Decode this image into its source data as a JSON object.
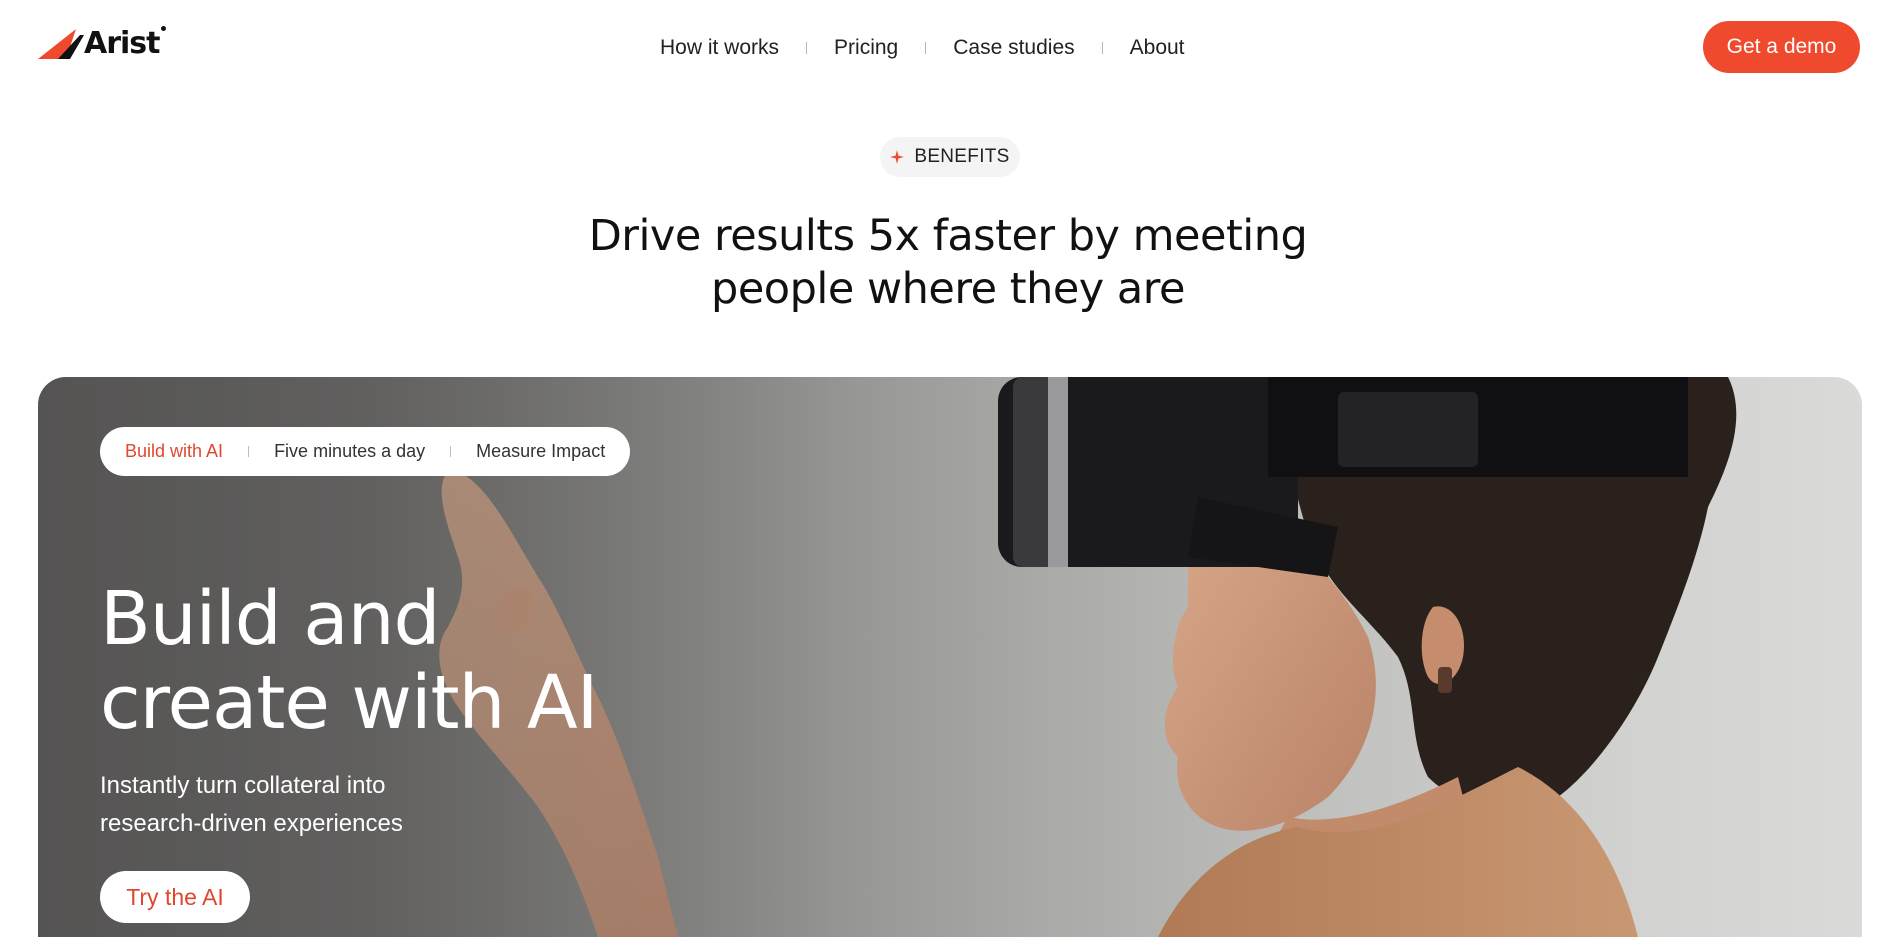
{
  "brand": {
    "name": "Arist",
    "accent_color": "#f04a2e"
  },
  "nav": {
    "items": [
      {
        "label": "How it works"
      },
      {
        "label": "Pricing"
      },
      {
        "label": "Case studies"
      },
      {
        "label": "About"
      }
    ],
    "cta_label": "Get a demo"
  },
  "section": {
    "badge": {
      "icon": "sparkle-icon",
      "label": "BENEFITS"
    },
    "headline_line1": "Drive results 5x faster by meeting",
    "headline_line2": "people where they are"
  },
  "hero": {
    "tabs": [
      {
        "label": "Build with AI",
        "active": true
      },
      {
        "label": "Five minutes a day",
        "active": false
      },
      {
        "label": "Measure Impact",
        "active": false
      }
    ],
    "title_line1": "Build and",
    "title_line2": "create with AI",
    "subtitle_line1": "Instantly turn collateral into",
    "subtitle_line2": "research-driven experiences",
    "cta_label": "Try the AI",
    "image": "person-wearing-vr-headset"
  }
}
